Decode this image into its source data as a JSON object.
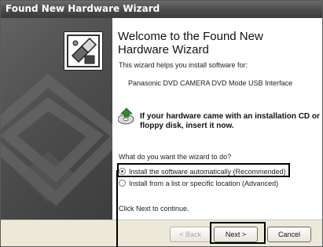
{
  "window": {
    "title": "Found New Hardware Wizard"
  },
  "icons": {
    "wizard": "hardware-wizard-icon",
    "cd": "cd-disk-icon"
  },
  "content": {
    "heading": "Welcome to the Found New Hardware Wizard",
    "intro": "This wizard helps you install software for:",
    "device": "Panasonic DVD CAMERA DVD Mode USB Interface",
    "note": "If your hardware came with an installation CD or floppy disk, insert it now.",
    "question": "What do you want the wizard to do?",
    "options": [
      {
        "label": "Install the software automatically (Recommended)",
        "selected": true
      },
      {
        "label": "Install from a list or specific location (Advanced)",
        "selected": false
      }
    ],
    "continue": "Click Next to continue."
  },
  "buttons": {
    "back": "< Back",
    "next": "Next >",
    "cancel": "Cancel"
  },
  "colors": {
    "title_bar": "#4a4a4a",
    "side_panel": "#555555",
    "footer": "#ece9d8"
  }
}
